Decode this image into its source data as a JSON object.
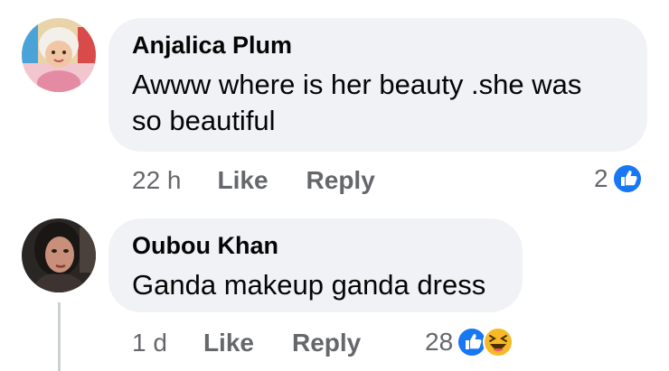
{
  "comments": [
    {
      "author": "Anjalica Plum",
      "text_line1": "Awww where is her beauty .she was",
      "text_line2": "so beautiful",
      "time": "22 h",
      "like": "Like",
      "reply": "Reply",
      "reaction_count": "2",
      "reactions": [
        "like-reaction-icon"
      ]
    },
    {
      "author": "Oubou Khan",
      "text_line1": "Ganda makeup ganda dress",
      "time": "1 d",
      "like": "Like",
      "reply": "Reply",
      "reaction_count": "28",
      "reactions": [
        "like-reaction-icon",
        "haha-reaction-icon"
      ]
    }
  ],
  "colors": {
    "bubble": "#f0f2f5",
    "meta_text": "#65676b",
    "like_blue": "#1877f2",
    "haha_yellow": "#f7b928"
  }
}
